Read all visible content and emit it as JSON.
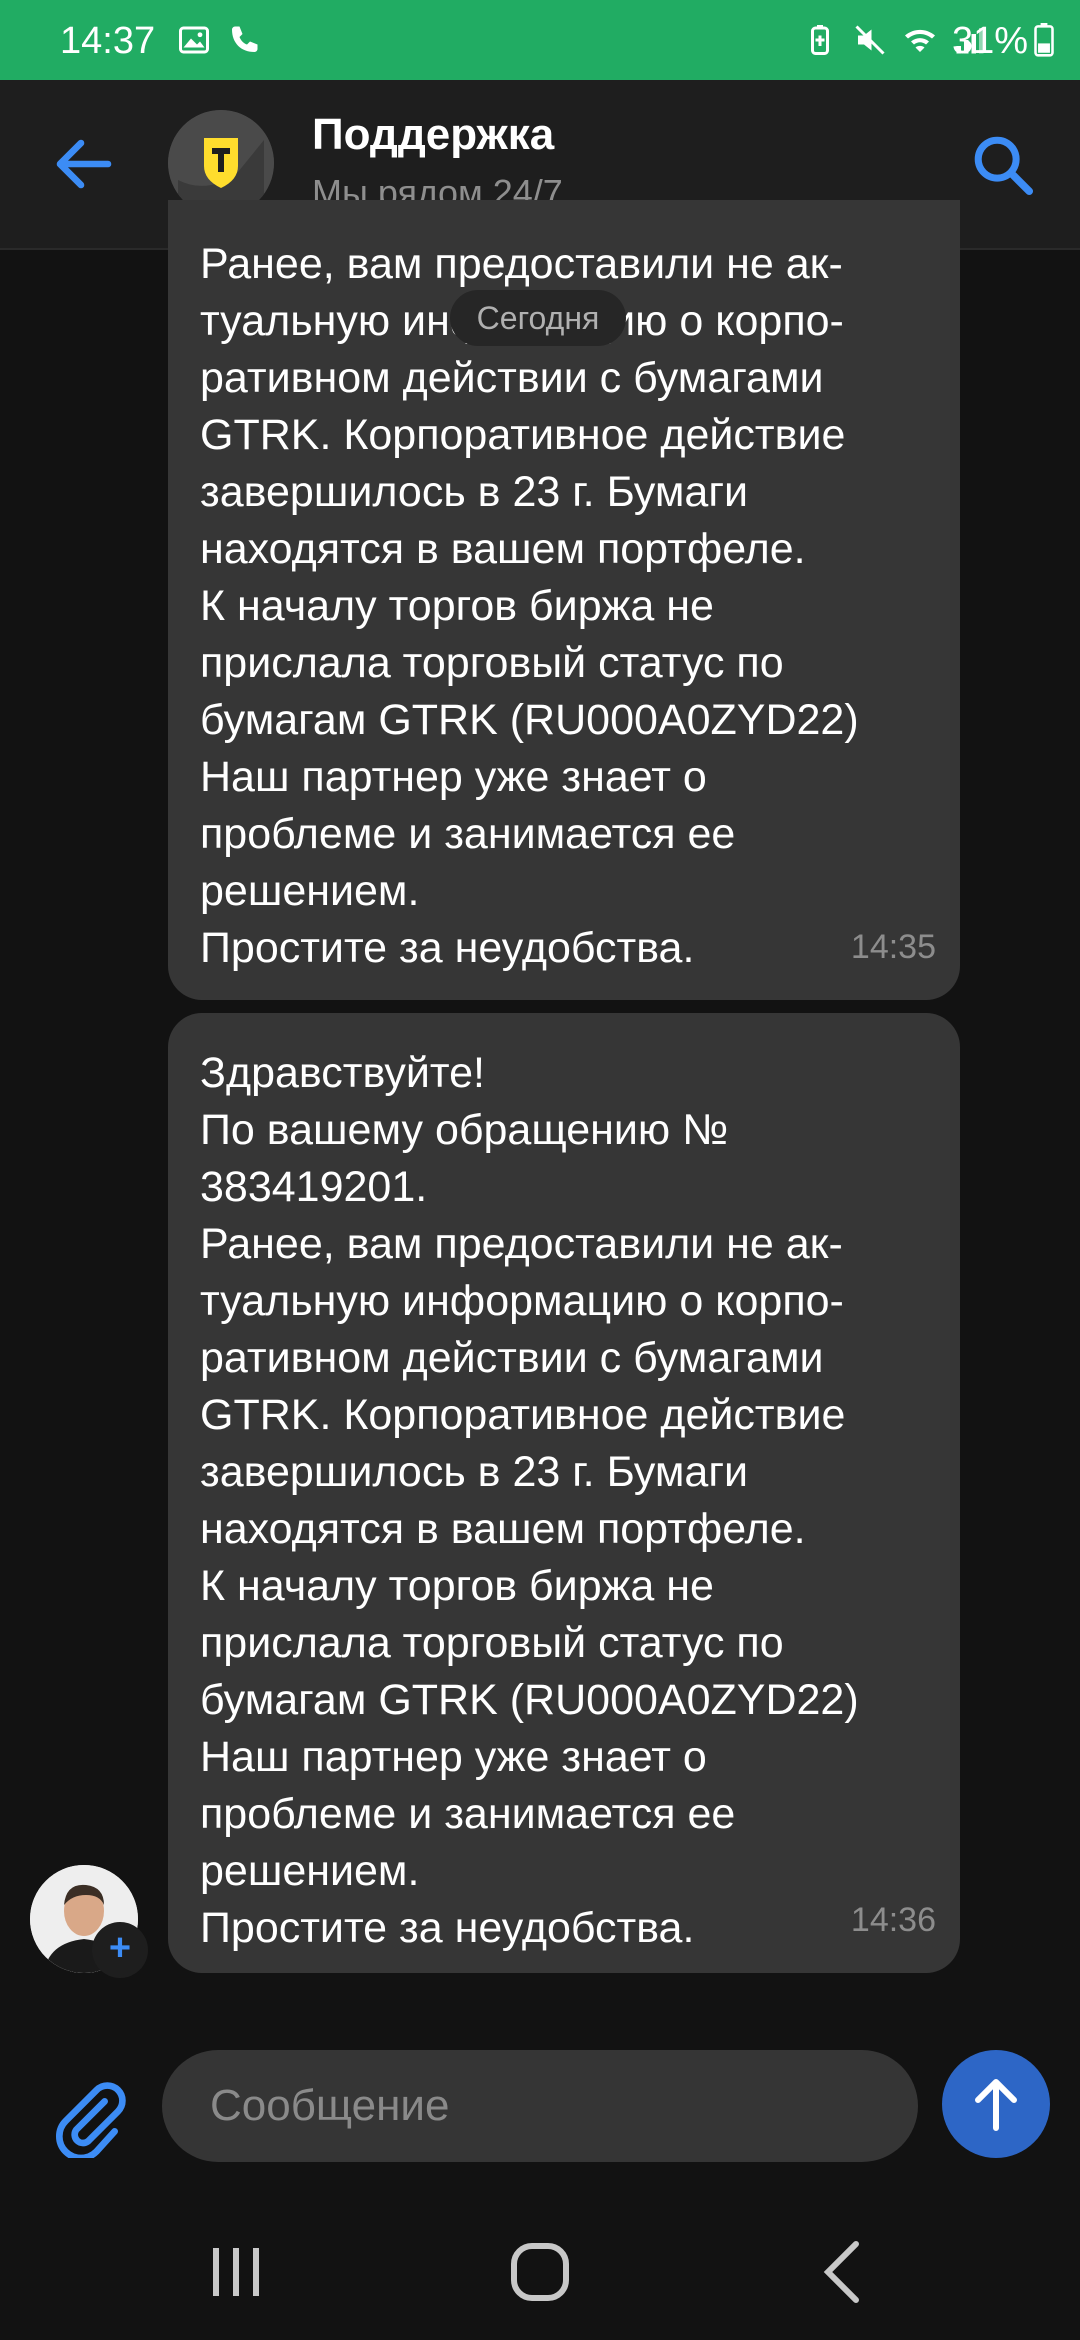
{
  "status_bar": {
    "time": "14:37",
    "battery": "31%"
  },
  "header": {
    "title": "Поддержка",
    "subtitle": "Мы рядом 24/7"
  },
  "date_separator": "Сегодня",
  "messages": [
    {
      "lines": [
        "Ранее, вам предоставили не ак-",
        "туальную информацию о корпо-",
        "ративном действии с бумагами",
        "GTRK. Корпоративное действие",
        "завершилось в 23 г. Бумаги",
        "находятся в вашем портфеле.",
        "К началу торгов биржа не",
        "прислала торговый статус по",
        "бумагам GTRK (RU000A0ZYD22)",
        "Наш партнер уже знает о",
        "проблеме и занимается ее",
        "решением.",
        "Простите за неудобства."
      ],
      "time": "14:35"
    },
    {
      "lines": [
        "Здравствуйте!",
        "По вашему обращению №",
        "383419201.",
        "Ранее, вам предоставили не ак-",
        "туальную информацию о корпо-",
        "ративном действии с бумагами",
        "GTRK. Корпоративное действие",
        "завершилось в 23 г. Бумаги",
        "находятся в вашем портфеле.",
        "К началу торгов биржа не",
        "прислала торговый статус по",
        "бумагам GTRK (RU000A0ZYD22)",
        "Наш партнер уже знает о",
        "проблеме и занимается ее",
        "решением.",
        "Простите за неудобства."
      ],
      "time": "14:36"
    }
  ],
  "composer": {
    "placeholder": "Сообщение"
  },
  "colors": {
    "status_bar": "#21ac63",
    "accent": "#3c8cf5",
    "bubble": "#363636",
    "send": "#2d66c6"
  },
  "icons": [
    "back-arrow-icon",
    "search-icon",
    "attach-icon",
    "send-arrow-icon",
    "recents-icon",
    "home-icon",
    "nav-back-icon"
  ]
}
